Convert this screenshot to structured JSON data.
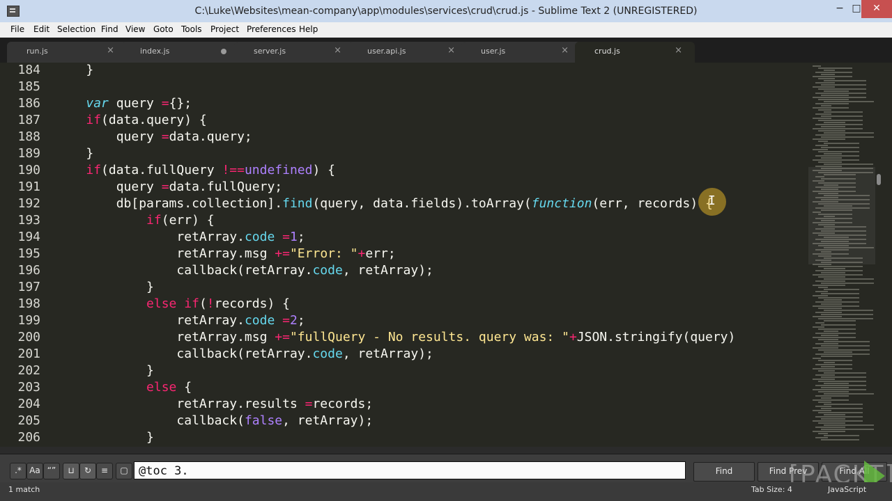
{
  "window": {
    "title": "C:\\Luke\\Websites\\mean-company\\app\\modules\\services\\crud\\crud.js - Sublime Text 2 (UNREGISTERED)",
    "min": "−",
    "max": "□",
    "close": "✕"
  },
  "menu": [
    "File",
    "Edit",
    "Selection",
    "Find",
    "View",
    "Goto",
    "Tools",
    "Project",
    "Preferences",
    "Help"
  ],
  "tabs": [
    {
      "label": "run.js",
      "state": "close"
    },
    {
      "label": "index.js",
      "state": "dirty"
    },
    {
      "label": "server.js",
      "state": "close"
    },
    {
      "label": "user.api.js",
      "state": "close"
    },
    {
      "label": "user.js",
      "state": "close"
    },
    {
      "label": "crud.js",
      "state": "close",
      "active": true
    }
  ],
  "editor": {
    "line_numbers": [
      "184",
      "185",
      "186",
      "187",
      "188",
      "189",
      "190",
      "191",
      "192",
      "193",
      "194",
      "195",
      "196",
      "197",
      "198",
      "199",
      "200",
      "201",
      "202",
      "203",
      "204",
      "205",
      "206"
    ],
    "lines": [
      "    }",
      "",
      "    var query ={};",
      "    if(data.query) {",
      "        query =data.query;",
      "    }",
      "    if(data.fullQuery !==undefined) {",
      "        query =data.fullQuery;",
      "        db[params.collection].find(query, data.fields).toArray(function(err, records) {",
      "            if(err) {",
      "                retArray.code =1;",
      "                retArray.msg +=\"Error: \"+err;",
      "                callback(retArray.code, retArray);",
      "            }",
      "            else if(!records) {",
      "                retArray.code =2;",
      "                retArray.msg +=\"fullQuery - No results. query was: \"+JSON.stringify(query)",
      "                callback(retArray.code, retArray);",
      "            }",
      "            else {",
      "                retArray.results =records;",
      "                callback(false, retArray);",
      "            }"
    ]
  },
  "find": {
    "toggles": [
      {
        "name": "regex",
        "glyph": ".*"
      },
      {
        "name": "case-sensitive",
        "glyph": "Aa"
      },
      {
        "name": "whole-word",
        "glyph": "“”"
      },
      {
        "name": "reverse",
        "glyph": "⊔"
      },
      {
        "name": "wrap",
        "glyph": "↻"
      },
      {
        "name": "in-selection",
        "glyph": "≡"
      },
      {
        "name": "highlight",
        "glyph": "▢"
      }
    ],
    "value": "@toc 3.",
    "find_label": "Find",
    "find_prev_label": "Find Prev",
    "find_all_label": "Find All"
  },
  "status": {
    "left": "1 match",
    "tab_size": "Tab Size: 4",
    "syntax": "JavaScript"
  },
  "watermark": "PACKT"
}
